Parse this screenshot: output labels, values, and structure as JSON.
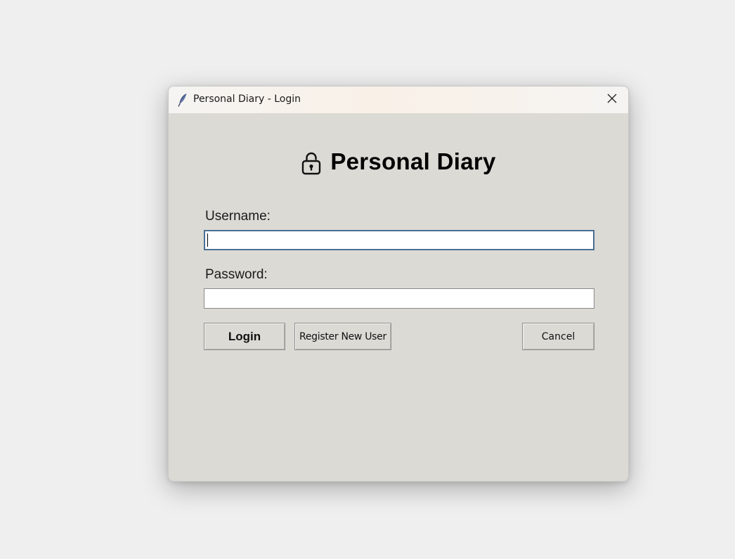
{
  "window": {
    "title": "Personal Diary - Login",
    "app_icon": "feather-icon",
    "close_icon": "close-icon"
  },
  "header": {
    "icon": "lock-icon",
    "title": "Personal Diary"
  },
  "form": {
    "username_label": "Username:",
    "username_value": "",
    "password_label": "Password:",
    "password_value": ""
  },
  "buttons": {
    "login": "Login",
    "register": "Register New User",
    "cancel": "Cancel"
  },
  "colors": {
    "window_bg": "#dcdad5",
    "focus_border": "#4a6f95"
  }
}
